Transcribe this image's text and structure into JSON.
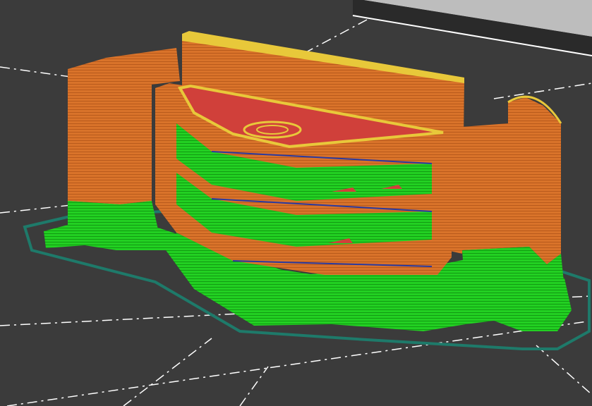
{
  "viewport": {
    "colors": {
      "background": "#3b3b3b",
      "bed_edge_band": "#2a2a2a",
      "outside_area": "#bdbdbd",
      "grid_line": "#ffffff",
      "skirt": "#1e7a6a",
      "support_green": "#22d022",
      "perimeter_orange": "#d9732a",
      "top_solid_red": "#d0403a",
      "bridge_yellow": "#e8c83a",
      "layer_blue": "#2a3aa0"
    }
  }
}
